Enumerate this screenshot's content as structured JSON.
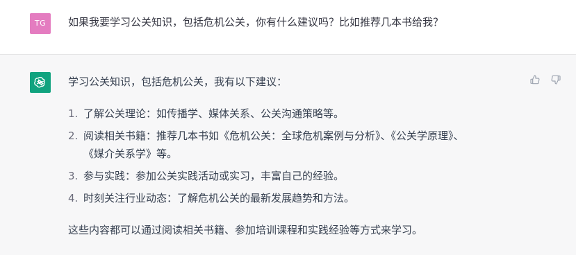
{
  "user_message": {
    "avatar_initials": "TG",
    "avatar_color": "#e47cc0",
    "text": "如果我要学习公关知识，包括危机公关，你有什么建议吗？比如推荐几本书给我？"
  },
  "assistant_message": {
    "avatar_icon": "openai-logo-icon",
    "avatar_color": "#10a37f",
    "intro": "学习公关知识，包括危机公关，我有以下建议：",
    "items": [
      {
        "num": "1.",
        "lines": [
          "了解公关理论：如传播学、媒体关系、公关沟通策略等。"
        ]
      },
      {
        "num": "2.",
        "lines": [
          "阅读相关书籍：推荐几本书如《危机公关：全球危机案例与分析》、《公关学原理》、",
          "《媒介关系学》等。"
        ]
      },
      {
        "num": "3.",
        "lines": [
          "参与实践：参加公关实践活动或实习，丰富自己的经验。"
        ]
      },
      {
        "num": "4.",
        "lines": [
          "时刻关注行业动态：了解危机公关的最新发展趋势和方法。"
        ]
      }
    ],
    "outro": "这些内容都可以通过阅读相关书籍、参加培训课程和实践经验等方式来学习。"
  },
  "feedback": {
    "thumbs_up_icon": "thumbs-up-icon",
    "thumbs_down_icon": "thumbs-down-icon"
  }
}
